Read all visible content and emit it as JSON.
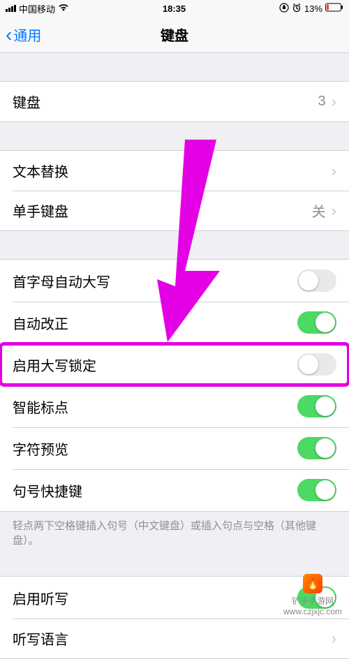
{
  "status": {
    "carrier": "中国移动",
    "time": "18:35",
    "battery": "13%"
  },
  "nav": {
    "back": "通用",
    "title": "键盘"
  },
  "group1": {
    "keyboards": {
      "label": "键盘",
      "value": "3"
    }
  },
  "group2": {
    "text_replacement": {
      "label": "文本替换"
    },
    "one_handed": {
      "label": "单手键盘",
      "value": "关"
    }
  },
  "group3": {
    "auto_cap": {
      "label": "首字母自动大写",
      "on": false
    },
    "auto_correct": {
      "label": "自动改正",
      "on": true
    },
    "caps_lock": {
      "label": "启用大写锁定",
      "on": false,
      "highlighted": true
    },
    "smart_punct": {
      "label": "智能标点",
      "on": true
    },
    "char_preview": {
      "label": "字符预览",
      "on": true
    },
    "period_shortcut": {
      "label": "\".\"快捷键",
      "display": "句号快捷键",
      "on": true
    },
    "footnote": "轻点两下空格键插入句号（中文键盘）或插入句点与空格（其他键盘）。"
  },
  "group4": {
    "dictation": {
      "label": "启用听写",
      "on": true
    },
    "dictation_lang": {
      "label": "听写语言"
    }
  },
  "watermark": {
    "text1": "铲子手游网",
    "text2": "www.czjxjc.com"
  },
  "colors": {
    "accent_blue": "#007aff",
    "toggle_on": "#4cd964",
    "highlight": "#e400e4"
  }
}
